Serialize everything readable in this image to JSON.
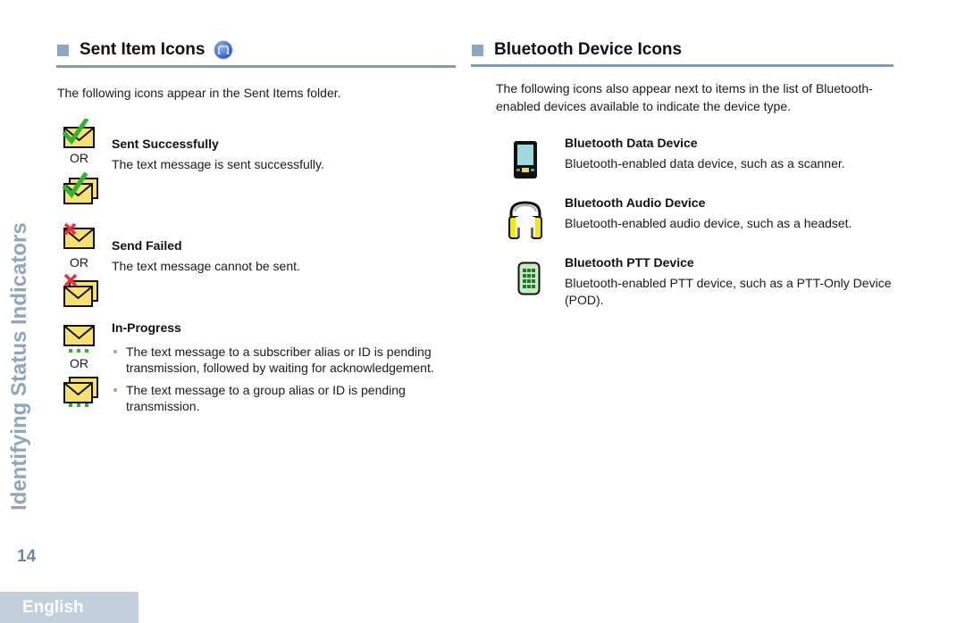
{
  "sidebar": {
    "chapter_title": "Identifying Status Indicators",
    "page_number": "14",
    "language_tab": "English"
  },
  "sent_items": {
    "title": "Sent Item Icons",
    "title_icon": "mode-indicator-icon",
    "intro": "The following icons appear in the Sent Items folder.",
    "or_label": "OR",
    "items": [
      {
        "title": "Sent Successfully",
        "description": "The text message is sent successfully.",
        "icons": [
          "envelope-check-icon",
          "envelopes-check-icon"
        ]
      },
      {
        "title": "Send Failed",
        "description": "The text message cannot be sent.",
        "icons": [
          "envelope-x-icon",
          "envelopes-x-icon"
        ]
      },
      {
        "title": "In-Progress",
        "icons": [
          "envelope-pending-icon",
          "envelopes-pending-icon"
        ],
        "bullets": [
          "The text message to a subscriber alias or ID is pending transmission, followed by waiting for acknowledgement.",
          "The text message to a group alias or ID is pending transmission."
        ]
      }
    ]
  },
  "bluetooth": {
    "title": "Bluetooth Device Icons",
    "intro": "The following icons also appear next to items in the list of Bluetooth-enabled devices available to indicate the device type.",
    "items": [
      {
        "title": "Bluetooth Data Device",
        "description": "Bluetooth-enabled data device, such as a scanner.",
        "icon": "data-device-icon"
      },
      {
        "title": "Bluetooth Audio Device",
        "description": "Bluetooth-enabled audio device, such as a headset.",
        "icon": "headset-icon"
      },
      {
        "title": "Bluetooth PTT Device",
        "description": "Bluetooth-enabled PTT device, such as a PTT-Only Device (POD).",
        "icon": "ptt-device-icon"
      }
    ]
  },
  "colors": {
    "accent": "#8ea6bf",
    "rule": "#7f9bb5",
    "envelope": "#f5e070",
    "check": "#2fb52f",
    "cross": "#e8303a"
  }
}
